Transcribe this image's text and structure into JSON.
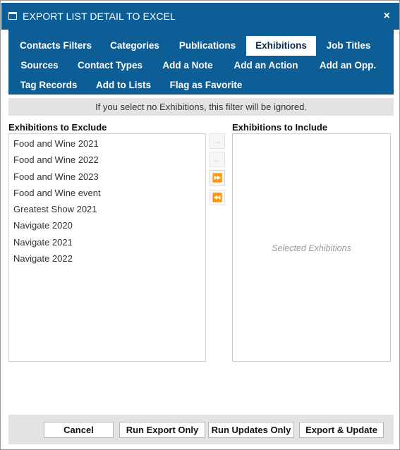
{
  "dialog": {
    "title": "EXPORT LIST DETAIL TO EXCEL",
    "close_label": "×"
  },
  "tabs": [
    {
      "label": "Contacts Filters"
    },
    {
      "label": "Categories"
    },
    {
      "label": "Publications"
    },
    {
      "label": "Exhibitions",
      "active": true
    },
    {
      "label": "Job Titles"
    },
    {
      "label": "Sources"
    },
    {
      "label": "Contact Types"
    },
    {
      "label": "Add a Note"
    },
    {
      "label": "Add an Action"
    },
    {
      "label": "Add an Opp."
    },
    {
      "label": "Tag Records"
    },
    {
      "label": "Add to Lists"
    },
    {
      "label": "Flag as Favorite"
    }
  ],
  "notice": "If you select no Exhibitions, this filter will be ignored.",
  "exclude": {
    "label": "Exhibitions to Exclude",
    "items": [
      "Food and Wine 2021",
      "Food and Wine 2022",
      "Food and Wine 2023",
      "Food and Wine event",
      "Greatest Show 2021",
      "Navigate 2020",
      "Navigate 2021",
      "Navigate 2022"
    ]
  },
  "include": {
    "label": "Exhibitions to Include",
    "placeholder": "Selected Exhibitions"
  },
  "transfer": {
    "move_right": "→",
    "move_left": "←",
    "move_all_right": "⏩",
    "move_all_left": "⏪"
  },
  "footer": {
    "cancel": "Cancel",
    "run_export": "Run Export Only",
    "run_updates": "Run Updates Only",
    "export_update": "Export & Update"
  }
}
